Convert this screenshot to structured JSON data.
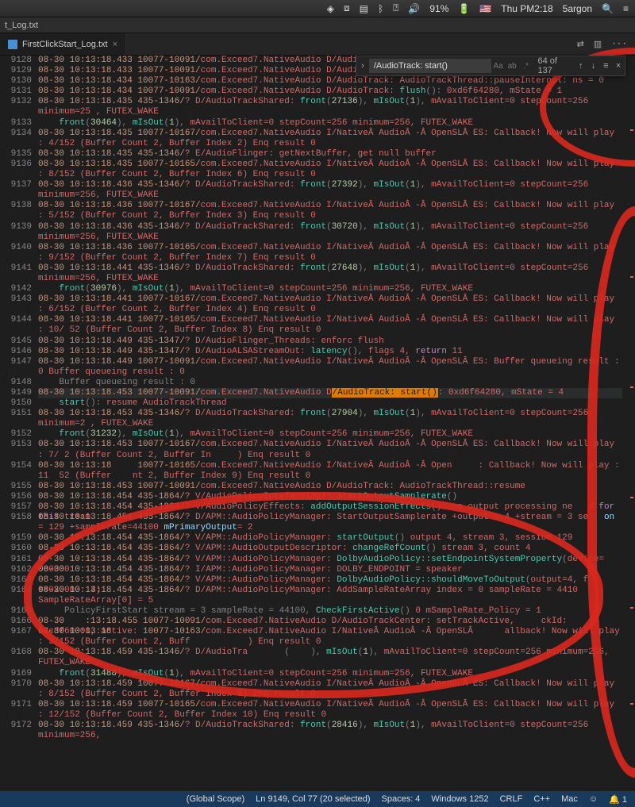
{
  "menubar": {
    "battery_pct": "91%",
    "clock": "Thu PM2:18",
    "user": "5argon"
  },
  "titlebar": {
    "filename": "t_Log.txt"
  },
  "tabs": [
    {
      "label": "FirstClickStart_Log.txt"
    }
  ],
  "header_icons": {
    "changes": "⇄",
    "split": "▥",
    "more": "···"
  },
  "findbar": {
    "query": "/AudioTrack: start()",
    "case": "Aa",
    "word": "ab",
    "regex": ".*",
    "count": "64 of 137"
  },
  "first_line_no": 9128,
  "statusbar": {
    "scope": "(Global Scope)",
    "pos": "Ln 9149, Col 77 (20 selected)",
    "spaces": "Spaces: 4",
    "encoding": "Windows 1252",
    "eol": "CRLF",
    "lang": "C++",
    "os": "Mac",
    "bell": "🔔 1"
  },
  "hl_index": 21,
  "lines": [
    [
      [
        "c-orange",
        "08-30 10:13:18.433 10077-10091/"
      ],
      [
        "c-red",
        "com.Exceed7.NativeAudio D/AudioTrack"
      ]
    ],
    [
      [
        "c-orange",
        "08-30 10:13:18.433 10077-10091/"
      ],
      [
        "c-red",
        "com.Exceed7.NativeAudio D/AudioTrack: audiotrack 0xd6f64280 stop done"
      ]
    ],
    [
      [
        "c-orange",
        "08-30 10:13:18.434 10077-10163/"
      ],
      [
        "c-red",
        "com.Exceed7.NativeAudio D/AudioTrack: AudioTrackThread::pauseInternal: ns = 0"
      ]
    ],
    [
      [
        "c-orange",
        "08-30 10:13:18.434 10077-10091/"
      ],
      [
        "c-red",
        "com.Exceed7.NativeAudio D/AudioTrack: "
      ],
      [
        "c-teal",
        "flush"
      ],
      [
        "c-gray",
        "(): "
      ],
      [
        "c-red",
        "0xd6f64280, mState = 1"
      ]
    ],
    [
      [
        "c-orange",
        "08-30 10:13:18.435 435-1346/"
      ],
      [
        "c-red",
        "? D/AudioTrackShared: "
      ],
      [
        "c-teal",
        "front"
      ],
      [
        "c-gray",
        "("
      ],
      [
        "c-num",
        "27136"
      ],
      [
        "c-gray",
        "), "
      ],
      [
        "c-teal",
        "mIsOut"
      ],
      [
        "c-gray",
        "("
      ],
      [
        "c-num",
        "1"
      ],
      [
        "c-gray",
        "), "
      ],
      [
        "c-red",
        "mAvailToClient=0 stepCount=256 minimum=25 , FUTEX_WAKE"
      ]
    ],
    [
      [
        "c-gray",
        "    "
      ],
      [
        "c-teal",
        "front"
      ],
      [
        "c-gray",
        "("
      ],
      [
        "c-num",
        "30464"
      ],
      [
        "c-gray",
        "), "
      ],
      [
        "c-teal",
        "mIsOut"
      ],
      [
        "c-gray",
        "("
      ],
      [
        "c-num",
        "1"
      ],
      [
        "c-gray",
        "), "
      ],
      [
        "c-red",
        "mAvailToClient=0 stepCount=256 minimum=256, FUTEX_WAKE"
      ]
    ],
    [
      [
        "c-orange",
        "08-30 10:13:18.435 10077-10167/"
      ],
      [
        "c-red",
        "com.Exceed7.NativeAudio I/NativeÂ AudioÂ -Â OpenSLÂ ES: Callback! Now will play : 4/152 (Buffer Count 2, Buffer Index 2) Enq result 0"
      ]
    ],
    [
      [
        "c-orange",
        "08-30 10:13:18.435 435-1346/"
      ],
      [
        "c-red",
        "? E/AudioFlinger: getNextBuffer, get null buffer"
      ]
    ],
    [
      [
        "c-orange",
        "08-30 10:13:18.435 10077-10165/"
      ],
      [
        "c-red",
        "com.Exceed7.NativeAudio I/NativeÂ AudioÂ -Â OpenSLÂ ES: Callback! Now will play : 8/152 (Buffer Count 2, Buffer Index 6) Enq result 0"
      ]
    ],
    [
      [
        "c-orange",
        "08-30 10:13:18.436 435-1346/"
      ],
      [
        "c-red",
        "? D/AudioTrackShared: "
      ],
      [
        "c-teal",
        "front"
      ],
      [
        "c-gray",
        "("
      ],
      [
        "c-num",
        "27392"
      ],
      [
        "c-gray",
        "), "
      ],
      [
        "c-teal",
        "mIsOut"
      ],
      [
        "c-gray",
        "("
      ],
      [
        "c-num",
        "1"
      ],
      [
        "c-gray",
        "), "
      ],
      [
        "c-red",
        "mAvailToClient=0 stepCount=256 minimum=256, FUTEX_WAKE"
      ]
    ],
    [
      [
        "c-orange",
        "08-30 10:13:18.436 10077-10167/"
      ],
      [
        "c-red",
        "com.Exceed7.NativeAudio I/NativeÂ AudioÂ -Â OpenSLÂ ES: Callback! Now will play : 5/152 (Buffer Count 2, Buffer Index 3) Enq result 0"
      ]
    ],
    [
      [
        "c-orange",
        "08-30 10:13:18.436 435-1346/"
      ],
      [
        "c-red",
        "? D/AudioTrackShared: "
      ],
      [
        "c-teal",
        "front"
      ],
      [
        "c-gray",
        "("
      ],
      [
        "c-num",
        "30720"
      ],
      [
        "c-gray",
        "), "
      ],
      [
        "c-teal",
        "mIsOut"
      ],
      [
        "c-gray",
        "("
      ],
      [
        "c-num",
        "1"
      ],
      [
        "c-gray",
        "), "
      ],
      [
        "c-red",
        "mAvailToClient=0 stepCount=256 minimum=256, FUTEX_WAKE"
      ]
    ],
    [
      [
        "c-orange",
        "08-30 10:13:18.436 10077-10165/"
      ],
      [
        "c-red",
        "com.Exceed7.NativeAudio I/NativeÂ AudioÂ -Â OpenSLÂ ES: Callback! Now will play : 9/152 (Buffer Count 2, Buffer Index 7) Enq result 0"
      ]
    ],
    [
      [
        "c-orange",
        "08-30 10:13:18.441 435-1346/"
      ],
      [
        "c-red",
        "? D/AudioTrackShared: "
      ],
      [
        "c-teal",
        "front"
      ],
      [
        "c-gray",
        "("
      ],
      [
        "c-num",
        "27648"
      ],
      [
        "c-gray",
        "), "
      ],
      [
        "c-teal",
        "mIsOut"
      ],
      [
        "c-gray",
        "("
      ],
      [
        "c-num",
        "1"
      ],
      [
        "c-gray",
        "), "
      ],
      [
        "c-red",
        "mAvailToClient=0 stepCount=256 minimum=256, FUTEX_WAKE"
      ]
    ],
    [
      [
        "c-gray",
        "    "
      ],
      [
        "c-teal",
        "front"
      ],
      [
        "c-gray",
        "("
      ],
      [
        "c-num",
        "30976"
      ],
      [
        "c-gray",
        "), "
      ],
      [
        "c-teal",
        "mIsOut"
      ],
      [
        "c-gray",
        "("
      ],
      [
        "c-num",
        "1"
      ],
      [
        "c-gray",
        "), "
      ],
      [
        "c-red",
        "mAvailToClient=0 stepCount=256 minimum=256, FUTEX_WAKE"
      ]
    ],
    [
      [
        "c-orange",
        "08-30 10:13:18.441 10077-10167/"
      ],
      [
        "c-red",
        "com.Exceed7.NativeAudio I/NativeÂ AudioÂ -Â OpenSLÂ ES: Callback! Now will play : 6/152 (Buffer Count 2, Buffer Index 4) Enq result 0"
      ]
    ],
    [
      [
        "c-orange",
        "08-30 10:13:18.441 10077-10165/"
      ],
      [
        "c-red",
        "com.Exceed7.NativeAudio I/NativeÂ AudioÂ -Â OpenSLÂ ES: Callback! Now will play : 10/ 52 (Buffer Count 2, Buffer Index 8) Enq result 0"
      ]
    ],
    [
      [
        "c-orange",
        "08-30 10:13:18.449 435-1347/"
      ],
      [
        "c-red",
        "? D/AudioFlinger_Threads: enforc flush"
      ]
    ],
    [
      [
        "c-orange",
        "08-30 10:13:18.449 435-1347/"
      ],
      [
        "c-red",
        "? D/AudioALSAStreamOut: "
      ],
      [
        "c-teal",
        "latency"
      ],
      [
        "c-gray",
        "(), "
      ],
      [
        "c-red",
        "flags 4, "
      ],
      [
        "c-pink",
        "return"
      ],
      [
        "c-red",
        " 11"
      ]
    ],
    [
      [
        "c-orange",
        "08-30 10:13:18.449 10077-10091/"
      ],
      [
        "c-red",
        "com.Exceed7.NativeAudio I/NativeÂ AudioÂ -Â OpenSLÂ ES: Buffer queueing result : 0 Buffer queueing result : 0"
      ]
    ],
    [
      [
        "c-gray",
        "    Buffer queueing result : 0"
      ]
    ],
    [
      [
        "c-orange",
        "08-30 10:13:18.453 10077-10091/"
      ],
      [
        "c-red",
        "com.Exceed7.NativeAudio D"
      ],
      [
        "sel",
        "/AudioTrack: start()"
      ],
      [
        "c-red",
        ": 0xd6f64280, mState = 4"
      ]
    ],
    [
      [
        "c-gray",
        "    "
      ],
      [
        "c-teal",
        "start"
      ],
      [
        "c-gray",
        "(): "
      ],
      [
        "c-red",
        "resume AudioTrackThread"
      ]
    ],
    [
      [
        "c-orange",
        "08-30 10:13:18.453 435-1346/"
      ],
      [
        "c-red",
        "? D/AudioTrackShared: "
      ],
      [
        "c-teal",
        "front"
      ],
      [
        "c-gray",
        "("
      ],
      [
        "c-num",
        "27904"
      ],
      [
        "c-gray",
        "), "
      ],
      [
        "c-teal",
        "mIsOut"
      ],
      [
        "c-gray",
        "("
      ],
      [
        "c-num",
        "1"
      ],
      [
        "c-gray",
        "), "
      ],
      [
        "c-red",
        "mAvailToClient=0 stepCount=256 minimum=2 , FUTEX_WAKE"
      ]
    ],
    [
      [
        "c-gray",
        "    "
      ],
      [
        "c-teal",
        "front"
      ],
      [
        "c-gray",
        "("
      ],
      [
        "c-num",
        "31232"
      ],
      [
        "c-gray",
        "), "
      ],
      [
        "c-teal",
        "mIsOut"
      ],
      [
        "c-gray",
        "("
      ],
      [
        "c-num",
        "1"
      ],
      [
        "c-gray",
        "), "
      ],
      [
        "c-red",
        "mAvailToClient=0 stepCount=256 minimum=256, FUTEX_WAKE"
      ]
    ],
    [
      [
        "c-orange",
        "08-30 10:13:18.453 10077-10167/"
      ],
      [
        "c-red",
        "com.Exceed7.NativeAudio I/NativeÂ AudioÂ -Â OpenSLÂ ES: Callback! Now will play : 7/ 2 (Buffer Count 2, Buffer In     ) Enq result 0"
      ]
    ],
    [
      [
        "c-orange",
        "08-30 10:13:18     10077-10165/"
      ],
      [
        "c-red",
        "com.Exceed7.NativeAudio I/NativeÂ AudioÂ -Â Open     : Callback! Now will play : 11  52 (Buffer    nt 2, Buffer Index 9) Enq result 0"
      ]
    ],
    [
      [
        "c-orange",
        "08-30 10:13:18.453 10077-10091/"
      ],
      [
        "c-red",
        "com.Exceed7.NativeAudio D/AudioTrack: AudioTrackThread::resume"
      ]
    ],
    [
      [
        "c-orange",
        "08-30 10:13:18.454 435-1864/"
      ],
      [
        "c-red",
        "? V/AudioPolicyIntefaceImpl: "
      ],
      [
        "c-teal",
        "StartOutputSamplerate"
      ],
      [
        "c-gray",
        "()"
      ]
    ],
    [
      [
        "c-orange",
        "08-30 10:13:18.454 435-1864/"
      ],
      [
        "c-red",
        "? V/AudioPolicyEffects: "
      ],
      [
        "c-teal",
        "addOutputSessionEffects"
      ],
      [
        "c-gray",
        "(): "
      ],
      [
        "c-red",
        "no output processing ne   d "
      ],
      [
        "c-pink",
        "for this"
      ],
      [
        "c-red",
        " tream"
      ]
    ],
    [
      [
        "c-orange",
        "08-30 10:13:18.454 435-1864/"
      ],
      [
        "c-red",
        "? D/APM::AudioPolicyManager: StartOutputSamplerate +output = 4 +stream = 3 se   "
      ],
      [
        "c-cyan",
        "on"
      ],
      [
        "c-red",
        " = 129 +samplerate=44100 "
      ],
      [
        "c-cyan",
        "mPrimaryOutput"
      ],
      [
        "c-red",
        "= 2"
      ]
    ],
    [
      [
        "c-orange",
        "08-30 10:13:18.454 435-1864/"
      ],
      [
        "c-red",
        "? V/APM::AudioPolicyManager: "
      ],
      [
        "c-teal",
        "startOutput"
      ],
      [
        "c-gray",
        "() "
      ],
      [
        "c-red",
        "output 4, stream 3, session 129"
      ]
    ],
    [
      [
        "c-orange",
        "08-30 10:13:18.454 435-1864/"
      ],
      [
        "c-red",
        "? V/APM::AudioOutputDescriptor: "
      ],
      [
        "c-teal",
        "changeRefCount"
      ],
      [
        "c-gray",
        "() "
      ],
      [
        "c-red",
        "stream 3, count 4"
      ]
    ],
    [
      [
        "c-orange",
        "08-30 10:13:18.454 435-1864/"
      ],
      [
        "c-red",
        "? V/APM::AudioPolicyManager: "
      ],
      [
        "c-teal",
        "DolbyAudioPolicy::setEndpointSystemProperty"
      ],
      [
        "c-gray",
        "("
      ],
      [
        "c-red",
        "device=   000000"
      ]
    ],
    [
      [
        "c-orange",
        "08-30 10:13:18.454 435-1864/"
      ],
      [
        "c-red",
        "? I/APM::AudioPolicyManager: DOLBY_ENDPOINT = speaker"
      ]
    ],
    [
      [
        "c-orange",
        "08-30 10:13:18.454 435-1864/"
      ],
      [
        "c-red",
        "? V/APM::AudioPolicyManager: "
      ],
      [
        "c-teal",
        "DolbyAudioPolicy::shouldMoveToOutput"
      ],
      [
        "c-gray",
        "("
      ],
      [
        "c-red",
        "output=4, f   s=0x0000  4)"
      ]
    ],
    [
      [
        "c-orange",
        "08-30 10:13:18.454 435-1864/"
      ],
      [
        "c-red",
        "? D/APM::AudioPolicyManager: AddSampleRateArray index = 0 sampleRate = 4410     SampleRateArray[0] = 5"
      ]
    ],
    [
      [
        "c-gray",
        "     PolicyFirstStart stream = 3 sampleRate = 44100, "
      ],
      [
        "c-teal",
        "CheckFirstActive"
      ],
      [
        "c-gray",
        "() "
      ],
      [
        "c-red",
        "0 mSampleRate_Policy = 1"
      ]
    ],
    [
      [
        "c-orange",
        "08-30    :13:18.455 10077-10091/"
      ],
      [
        "c-red",
        "com.Exceed7.NativeAudio D/AudioTrackCenter: setTrackActive,     ckId: 0xcdf60000, active: "
      ]
    ],
    [
      [
        "c-orange",
        "08-30 10:13:18      10077-10163/"
      ],
      [
        "c-red",
        "com.Exceed7.NativeAudio I/NativeÂ AudioÂ -Â OpenSLÂ      allback! Now will play : 3/152 (Buffer Count 2, Buff           ) Enq result 0"
      ]
    ],
    [
      [
        "c-orange",
        "08-30 10:13:18.459 435-1346/"
      ],
      [
        "c-red",
        "? D/AudioTra    "
      ],
      [
        "c-teal",
        "   "
      ],
      [
        "c-gray",
        "(    "
      ],
      [
        "c-gray",
        "), "
      ],
      [
        "c-teal",
        "mIsOut"
      ],
      [
        "c-gray",
        "("
      ],
      [
        "c-num",
        "1"
      ],
      [
        "c-gray",
        "), "
      ],
      [
        "c-red",
        "mAvailToClient=0 stepCount=256 minimum=256, FUTEX_WAKE"
      ]
    ],
    [
      [
        "c-gray",
        "    "
      ],
      [
        "c-teal",
        "front"
      ],
      [
        "c-gray",
        "("
      ],
      [
        "c-num",
        "31488"
      ],
      [
        "c-gray",
        "), "
      ],
      [
        "c-teal",
        "mIsOut"
      ],
      [
        "c-gray",
        "("
      ],
      [
        "c-num",
        "1"
      ],
      [
        "c-gray",
        "), "
      ],
      [
        "c-red",
        "mAvailToClient=0 stepCount=256 minimum=256, FUTEX_WAKE"
      ]
    ],
    [
      [
        "c-orange",
        "08-30 10:13:18.459 10077-10167/"
      ],
      [
        "c-red",
        "com.Exceed7.NativeAudio I/NativeÂ AudioÂ -Â OpenSLÂ ES: Callback! Now will play : 8/152 (Buffer Count 2, Buffer Index 6) Enq result 0"
      ]
    ],
    [
      [
        "c-orange",
        "08-30 10:13:18.459 10077-10165/"
      ],
      [
        "c-red",
        "com.Exceed7.NativeAudio I/NativeÂ AudioÂ -Â OpenSLÂ ES: Callback! Now will play : 12/152 (Buffer Count 2, Buffer Index 10) Enq result 0"
      ]
    ],
    [
      [
        "c-orange",
        "08-30 10:13:18.459 435-1346/"
      ],
      [
        "c-red",
        "? D/AudioTrackShared: "
      ],
      [
        "c-teal",
        "front"
      ],
      [
        "c-gray",
        "("
      ],
      [
        "c-num",
        "28416"
      ],
      [
        "c-gray",
        "), "
      ],
      [
        "c-teal",
        "mIsOut"
      ],
      [
        "c-gray",
        "("
      ],
      [
        "c-num",
        "1"
      ],
      [
        "c-gray",
        "), "
      ],
      [
        "c-red",
        "mAvailToClient=0 stepCount=256 minimum=256,"
      ]
    ]
  ],
  "physical_rows": [
    1,
    1,
    1,
    1,
    2,
    1,
    2,
    1,
    2,
    2,
    2,
    2,
    2,
    2,
    1,
    2,
    2,
    1,
    1,
    2,
    1,
    1,
    1,
    2,
    1,
    2,
    2,
    1,
    1,
    1,
    2,
    1,
    1,
    1,
    1,
    1,
    2,
    1,
    1,
    2,
    2,
    1,
    2,
    2,
    1
  ]
}
